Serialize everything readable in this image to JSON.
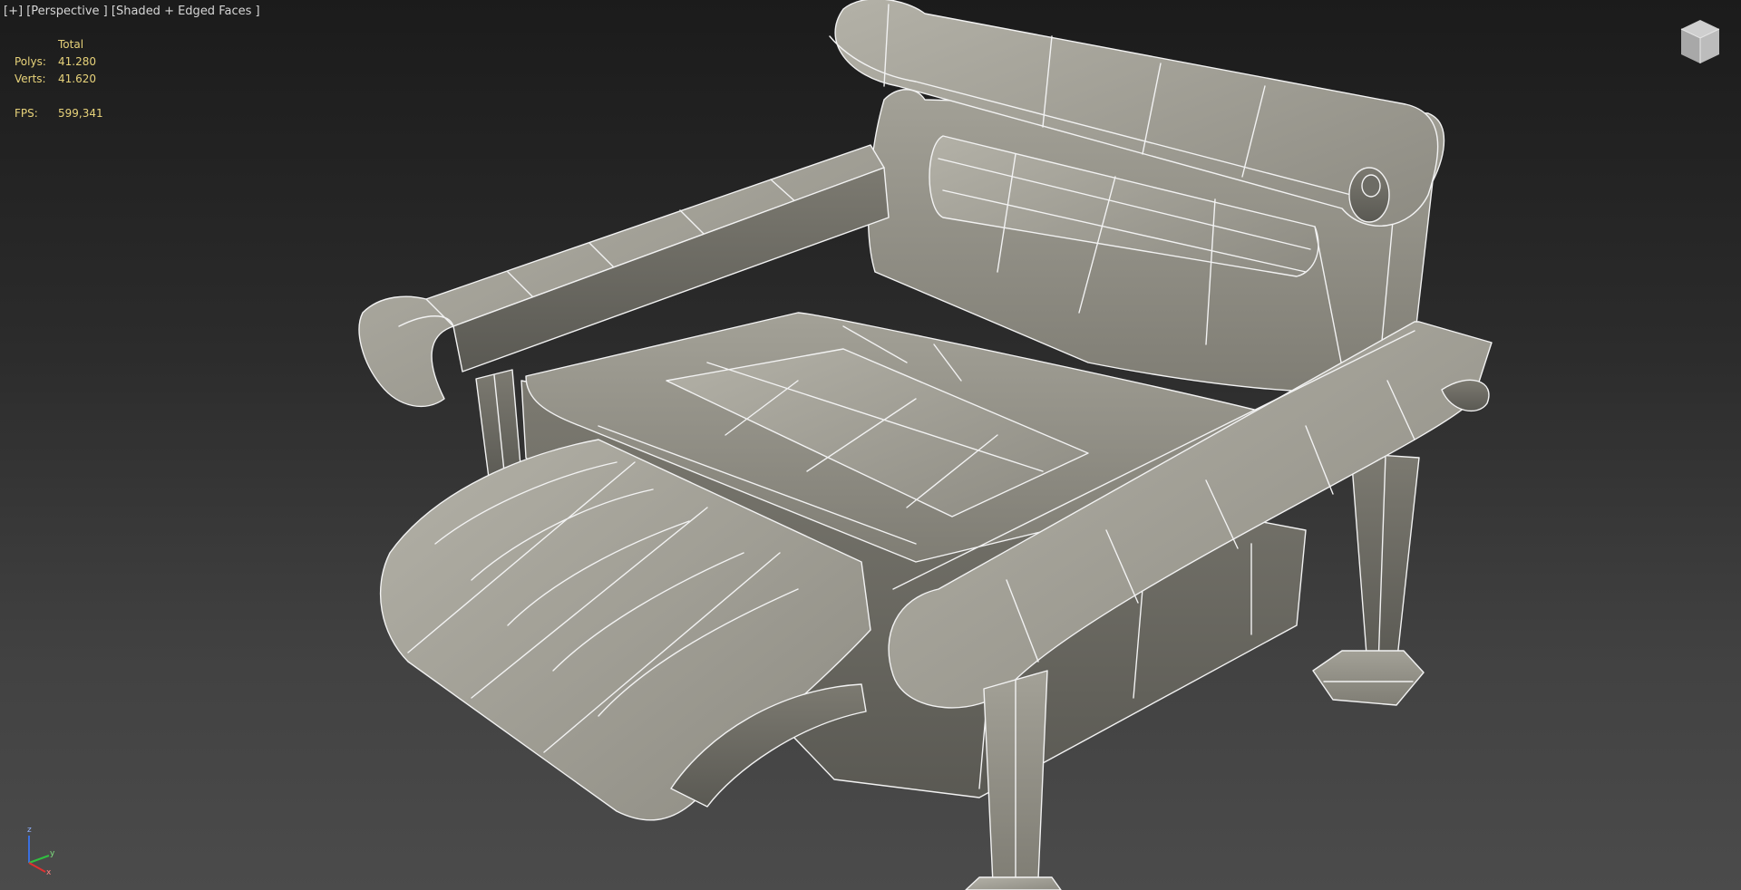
{
  "viewport": {
    "label_plus": "[+]",
    "label_view": "[Perspective ]",
    "label_shading": "[Shaded + Edged Faces ]"
  },
  "stats": {
    "header": "Total",
    "polys_label": "Polys:",
    "polys_value": "41.280",
    "verts_label": "Verts:",
    "verts_value": "41.620",
    "fps_label": "FPS:",
    "fps_value": "599,341"
  },
  "axes": {
    "z": "z",
    "y": "y",
    "x": "x"
  },
  "colors": {
    "stats_text": "#e7d27a",
    "label_text": "#d6d6d6",
    "mesh_fill": "#8e8c82",
    "wire": "#f2f2f2"
  },
  "icons": [
    "viewcube-icon",
    "axis-tripod-icon"
  ]
}
